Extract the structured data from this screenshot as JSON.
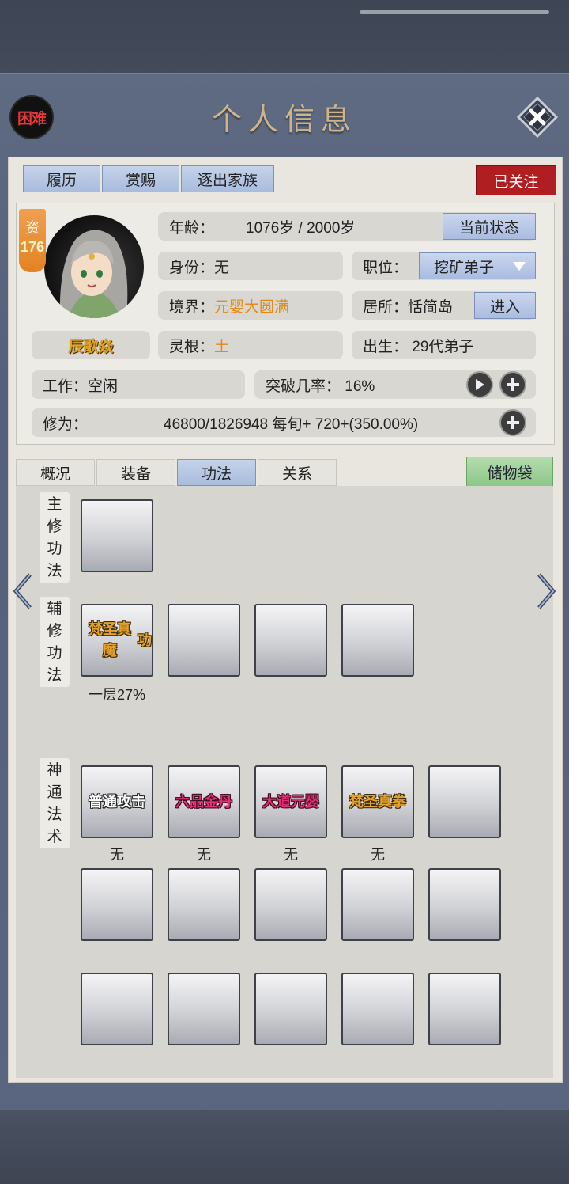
{
  "header": {
    "difficulty": "困难",
    "title": "个人信息"
  },
  "top_tabs": [
    "履历",
    "赏赐",
    "逐出家族"
  ],
  "follow_label": "已关注",
  "character": {
    "aptitude_label": "资",
    "aptitude_value": "176",
    "name": "辰歌焱"
  },
  "info": {
    "age_label": "年龄：",
    "age_value": "1076岁 / 2000岁",
    "status_button": "当前状态",
    "identity": "身份：无",
    "position_label": "职位：",
    "position_value": "挖矿弟子",
    "realm_label": "境界：",
    "realm_value": "元婴大圆满",
    "residence": "居所：恬简岛",
    "enter_button": "进入",
    "root_label": "灵根：",
    "root_value": "土",
    "birth": "出生：  29代弟子",
    "work": "工作：空闲",
    "breakthrough": "突破几率：  16%",
    "cultivation_label": "修为：",
    "cultivation_value": "46800/1826948  每旬+  720+(350.00%)"
  },
  "sub_tabs": [
    "概况",
    "装备",
    "功法",
    "关系"
  ],
  "active_sub_tab": "功法",
  "bag_button": "储物袋",
  "skills": {
    "main_label": "主修功法",
    "aux_label": "辅修功法",
    "aux_slots": [
      {
        "name": "梵圣真魔功",
        "caption": "一层27%"
      }
    ],
    "magic_label": "神通法术",
    "magic_slots": [
      {
        "name": "普通攻击",
        "caption": "无"
      },
      {
        "name": "六品金丹",
        "caption": "无"
      },
      {
        "name": "大道元婴",
        "caption": "无"
      },
      {
        "name": "梵圣真拳",
        "caption": "无"
      }
    ]
  },
  "colors": {
    "accent_blue": "#a9bcdd",
    "follow_red": "#b01e22",
    "orange_text": "#e28a1a",
    "bag_green": "#8cc788"
  }
}
